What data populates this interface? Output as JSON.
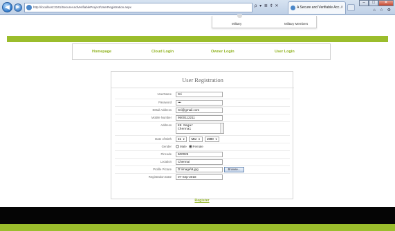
{
  "browser": {
    "back_glyph": "◀",
    "forward_glyph": "▶",
    "address": "http://localhost:3341/SecureAndVerifiableProject/UserRegistration.aspx",
    "address_tools": "ρ ▾ ≣ ¢ ✕",
    "tab_title": "A Secure and Verifiable Acc...",
    "tab_close": "×",
    "right_tools": "⌂ ☆ ⚙",
    "window_buttons": {
      "min": "–",
      "max": "□",
      "close": "✕"
    }
  },
  "topnav": {
    "item1": "Military",
    "item2": "Military Members"
  },
  "menu": [
    {
      "label": "Homepage"
    },
    {
      "label": "Cloud Login"
    },
    {
      "label": "Owner Login"
    },
    {
      "label": "User Login"
    }
  ],
  "form": {
    "title": "User Registration",
    "fields": {
      "username": {
        "label": "UserName",
        "value": "Sri"
      },
      "password": {
        "label": "Password",
        "value": "•••"
      },
      "email": {
        "label": "EMail Address",
        "value": "Sri@gmail.com"
      },
      "mobile": {
        "label": "Mobile Number",
        "value": "9500112211"
      },
      "address": {
        "label": "Address",
        "line1": "KK Nagar",
        "line2": "Chennai"
      },
      "dob": {
        "label": "Date of Birth",
        "day": "31",
        "month": "Mar",
        "year": "1990"
      },
      "gender": {
        "label": "Gender",
        "option1": "Male",
        "option2": "Female",
        "selected": "Female"
      },
      "pincode": {
        "label": "Pincode",
        "value": "600026"
      },
      "location": {
        "label": "Location",
        "value": "Chennai"
      },
      "profile": {
        "label": "Profile Picture",
        "value": "D:\\image\\9.jpg",
        "browse_label": "Browse..."
      },
      "regdate": {
        "label": "Registration Date",
        "value": "07-Sep-2018"
      }
    },
    "submit_label": "Register"
  },
  "colors": {
    "accent_green": "#9bbd2c",
    "menu_text_green": "#8fb21e",
    "footer_black": "#050505"
  }
}
